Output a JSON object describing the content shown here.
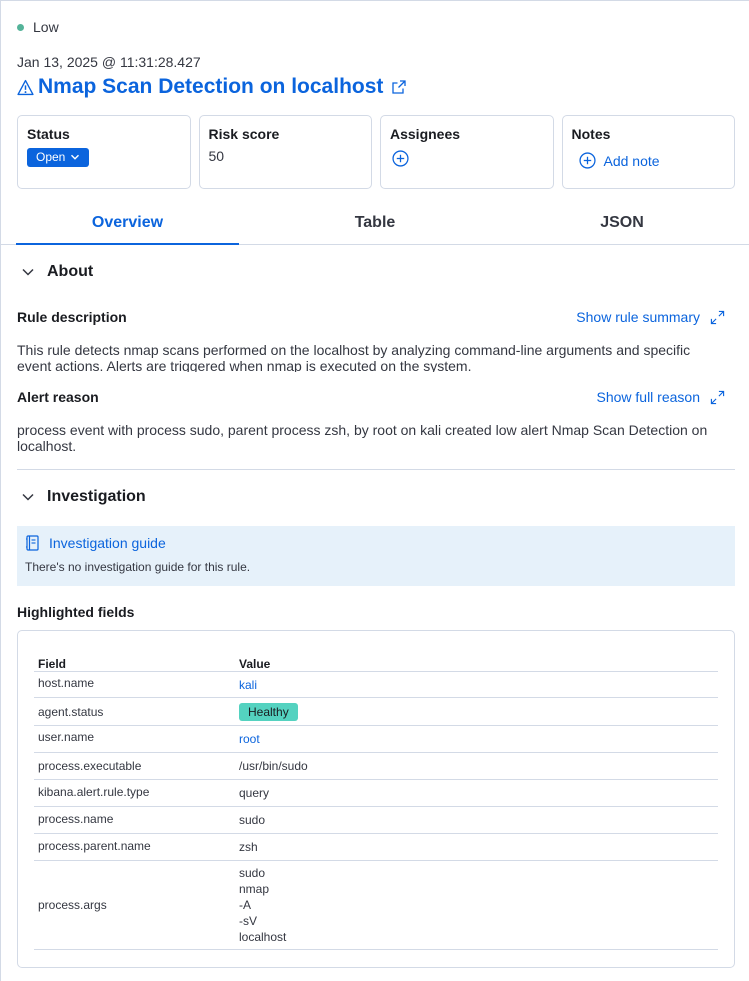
{
  "severity": {
    "label": "Low",
    "color": "#54b399"
  },
  "timestamp": "Jan 13, 2025 @ 11:31:28.427",
  "alert": {
    "title": "Nmap Scan Detection on localhost",
    "title_icon": "warning-icon",
    "link_icon": "external-link-icon"
  },
  "cards": {
    "status": {
      "label": "Status",
      "value": "Open"
    },
    "risk": {
      "label": "Risk score",
      "value": "50"
    },
    "assignees": {
      "label": "Assignees"
    },
    "notes": {
      "label": "Notes",
      "action": "Add note"
    }
  },
  "tabs": [
    {
      "label": "Overview",
      "active": true
    },
    {
      "label": "Table",
      "active": false
    },
    {
      "label": "JSON",
      "active": false
    }
  ],
  "about": {
    "title": "About",
    "rule_description_label": "Rule description",
    "show_rule_summary": "Show rule summary",
    "rule_description": "This rule detects nmap scans performed on the localhost by analyzing command-line arguments and specific event actions. Alerts are triggered when nmap is executed on the system.",
    "alert_reason_label": "Alert reason",
    "show_full_reason": "Show full reason",
    "alert_reason": "process event with process sudo, parent process zsh, by root on kali created low alert Nmap Scan Detection on localhost."
  },
  "investigation": {
    "title": "Investigation",
    "guide_title": "Investigation guide",
    "guide_empty": "There's no investigation guide for this rule.",
    "highlighted_title": "Highlighted fields",
    "col_field": "Field",
    "col_value": "Value",
    "rows": [
      {
        "field": "host.name",
        "value": "kali"
      },
      {
        "field": "agent.status",
        "value": "Healthy"
      },
      {
        "field": "user.name",
        "value": "root"
      },
      {
        "field": "process.executable",
        "value": "/usr/bin/sudo"
      },
      {
        "field": "kibana.alert.rule.type",
        "value": "query"
      },
      {
        "field": "process.name",
        "value": "sudo"
      },
      {
        "field": "process.parent.name",
        "value": "zsh"
      },
      {
        "field": "process.args",
        "values": [
          "sudo",
          "nmap",
          "-A",
          "-sV",
          "localhost"
        ]
      }
    ]
  },
  "colors": {
    "accent": "#0b64dd",
    "healthy": "#54d2c0",
    "guide_bg": "#e6f1fa",
    "border": "#d3dae6"
  }
}
